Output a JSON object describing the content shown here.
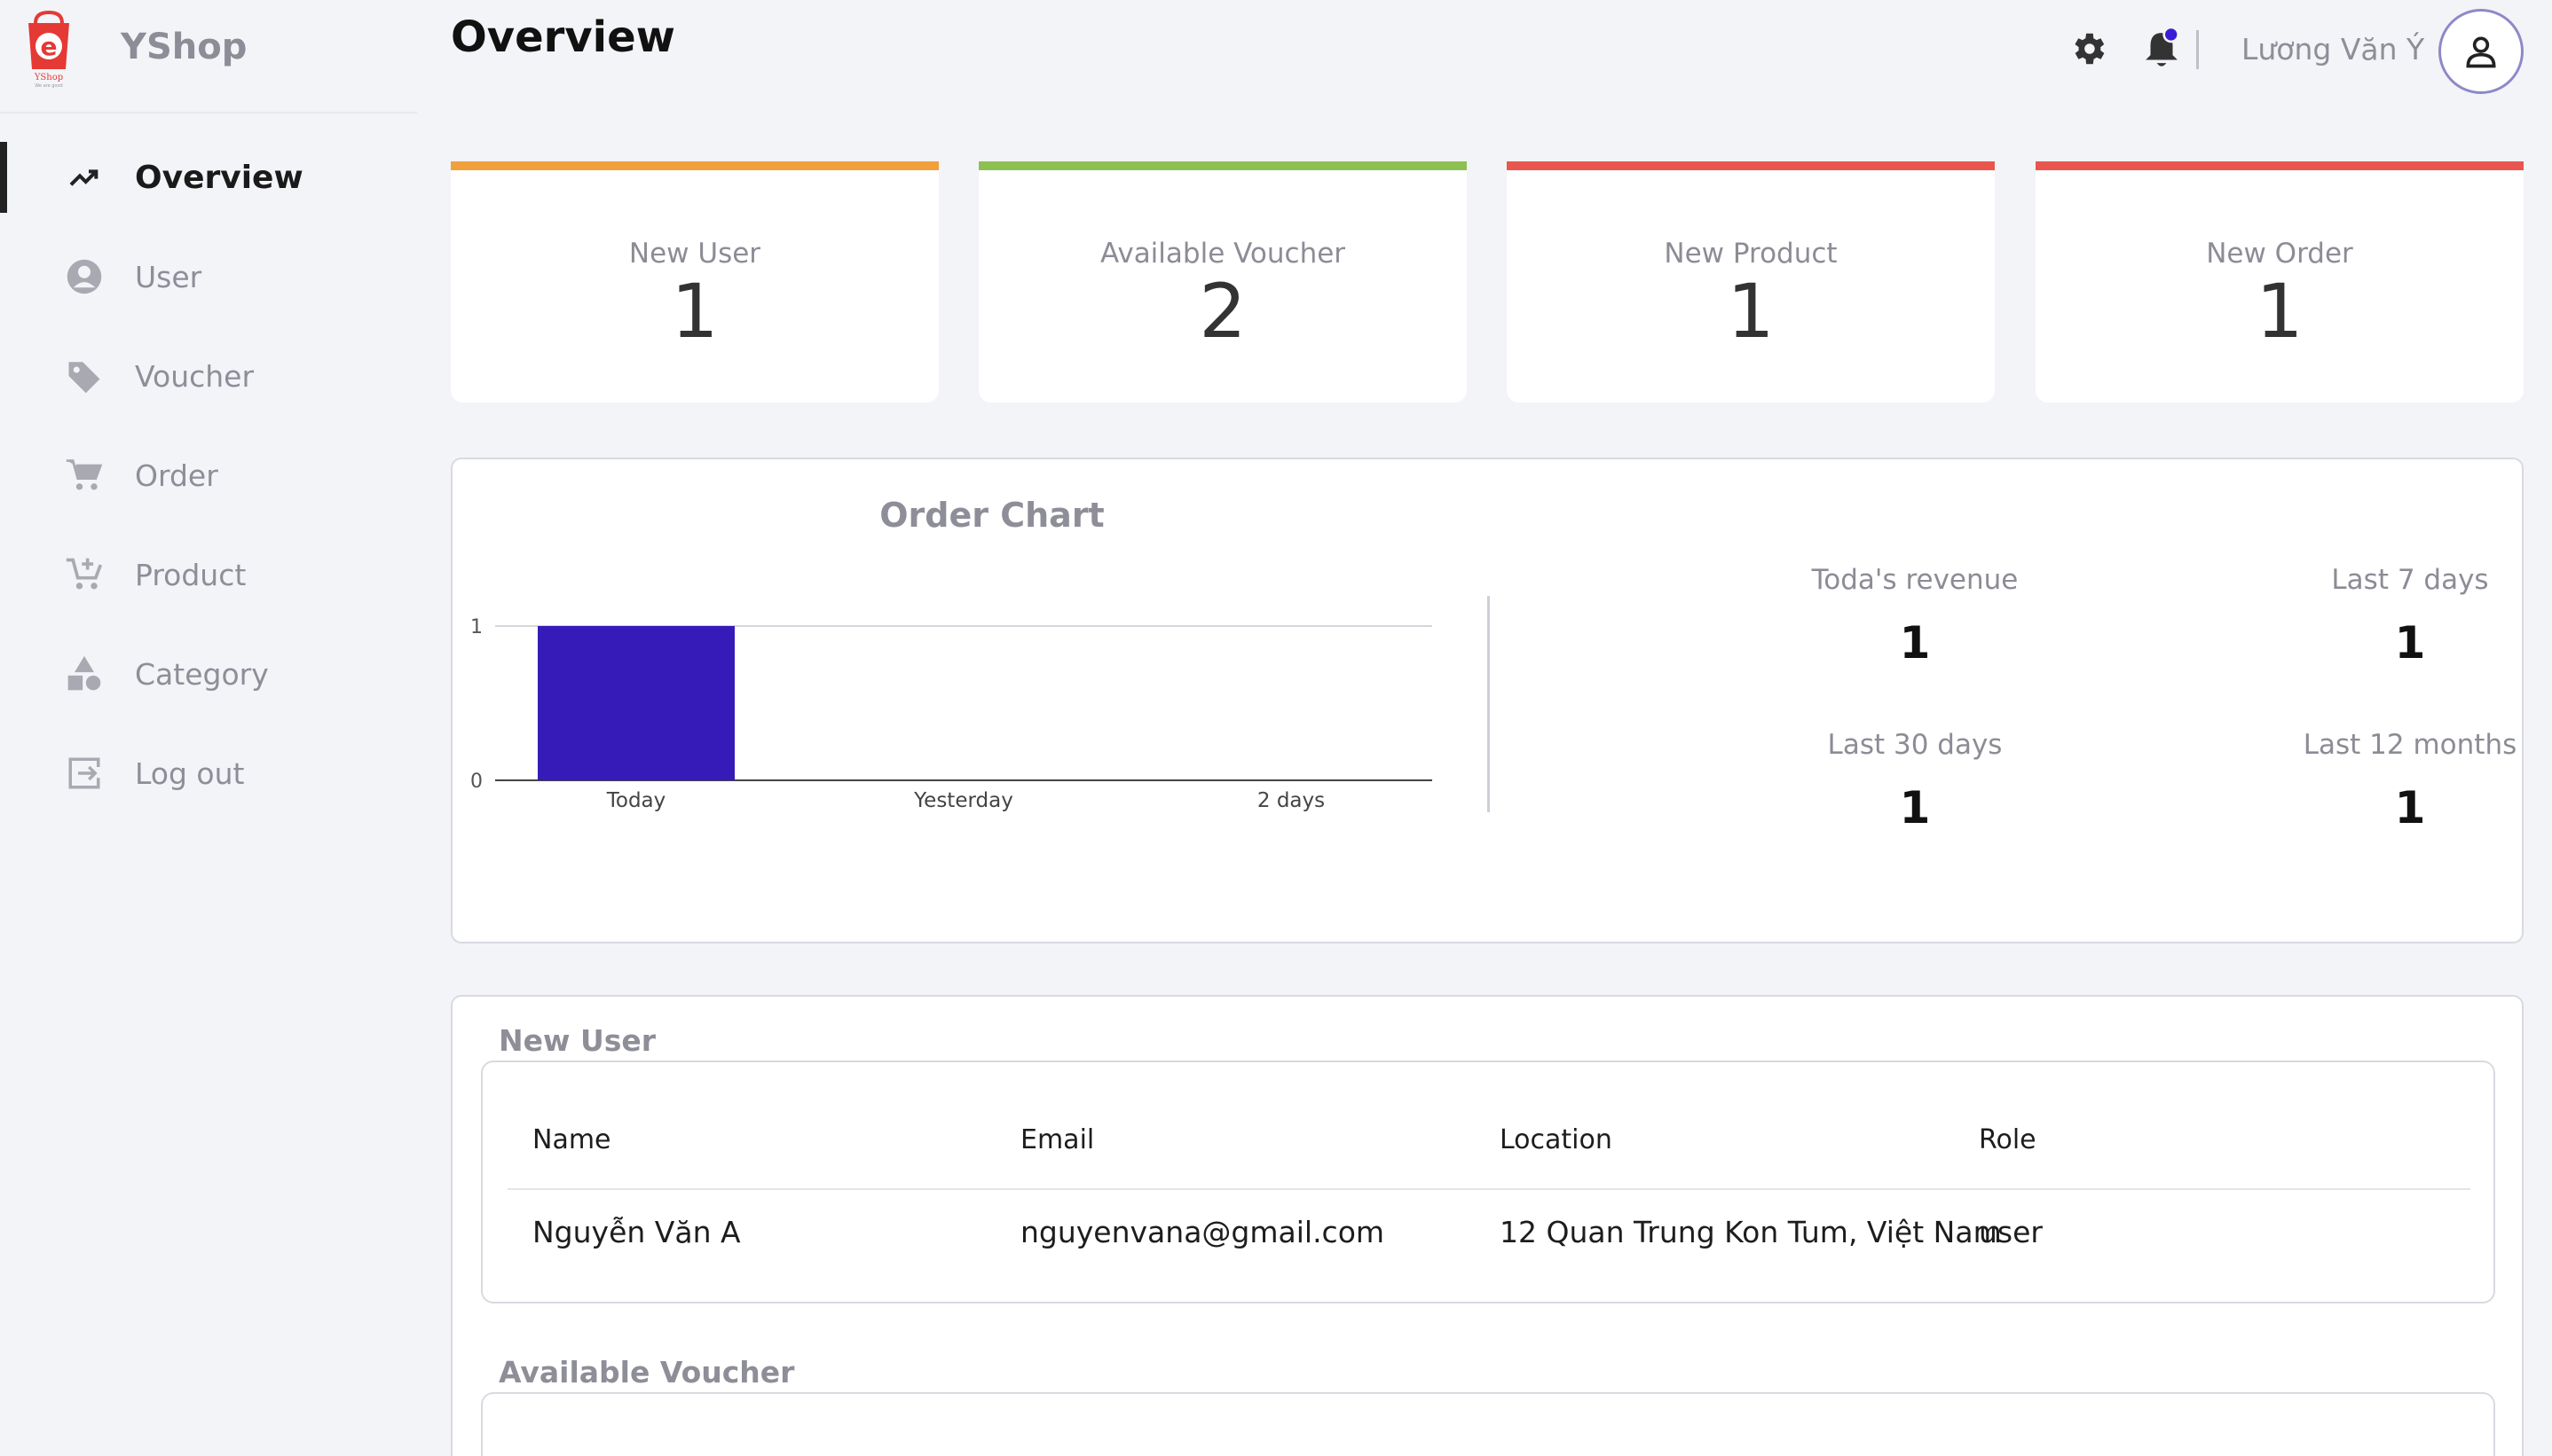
{
  "brand": {
    "name": "YShop",
    "logo_text": "YShop"
  },
  "nav": {
    "items": [
      {
        "label": "Overview",
        "icon": "trending-up-icon",
        "active": true
      },
      {
        "label": "User",
        "icon": "user-circle-icon",
        "active": false
      },
      {
        "label": "Voucher",
        "icon": "tag-icon",
        "active": false
      },
      {
        "label": "Order",
        "icon": "cart-icon",
        "active": false
      },
      {
        "label": "Product",
        "icon": "cart-plus-icon",
        "active": false
      },
      {
        "label": "Category",
        "icon": "shapes-icon",
        "active": false
      },
      {
        "label": "Log out",
        "icon": "logout-icon",
        "active": false
      }
    ]
  },
  "header": {
    "title": "Overview",
    "username": "Lương Văn Ý",
    "has_notification": true
  },
  "stats": [
    {
      "label": "New User",
      "value": "1",
      "color": "#f0a13d"
    },
    {
      "label": "Available Voucher",
      "value": "2",
      "color": "#8cc152"
    },
    {
      "label": "New Product",
      "value": "1",
      "color": "#e9564f"
    },
    {
      "label": "New Order",
      "value": "1",
      "color": "#e9564f"
    }
  ],
  "chart_data": {
    "type": "bar",
    "title": "Order Chart",
    "categories": [
      "Today",
      "Yesterday",
      "2 days"
    ],
    "values": [
      1,
      0,
      0
    ],
    "ylim": [
      0,
      1
    ],
    "yticks": [
      "0",
      "1"
    ],
    "grid": true,
    "bar_color": "#371bb8"
  },
  "summary": {
    "items": [
      {
        "label": "Toda's revenue",
        "value": "1"
      },
      {
        "label": "Last 7 days",
        "value": "1"
      },
      {
        "label": "Last 30 days",
        "value": "1"
      },
      {
        "label": "Last 12 months",
        "value": "1"
      }
    ]
  },
  "new_user": {
    "title": "New User",
    "columns": [
      "Name",
      "Email",
      "Location",
      "Role"
    ],
    "rows": [
      [
        "Nguyễn Văn A",
        "nguyenvana@gmail.com",
        "12 Quan Trung Kon Tum, Việt Nam",
        "user"
      ]
    ]
  },
  "available_voucher": {
    "title": "Available Voucher"
  }
}
